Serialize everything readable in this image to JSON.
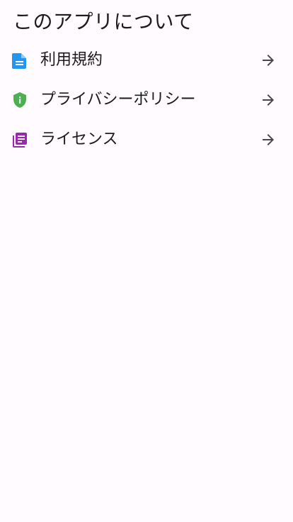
{
  "header": {
    "title": "このアプリについて"
  },
  "menu": {
    "items": [
      {
        "label": "利用規約",
        "icon": "document-icon",
        "color": "#2196f3"
      },
      {
        "label": "プライバシーポリシー",
        "icon": "shield-info-icon",
        "color": "#4caf50"
      },
      {
        "label": "ライセンス",
        "icon": "library-books-icon",
        "color": "#9c27b0"
      }
    ],
    "trailing_icon": "arrow-forward-icon",
    "trailing_color": "#49454f"
  }
}
